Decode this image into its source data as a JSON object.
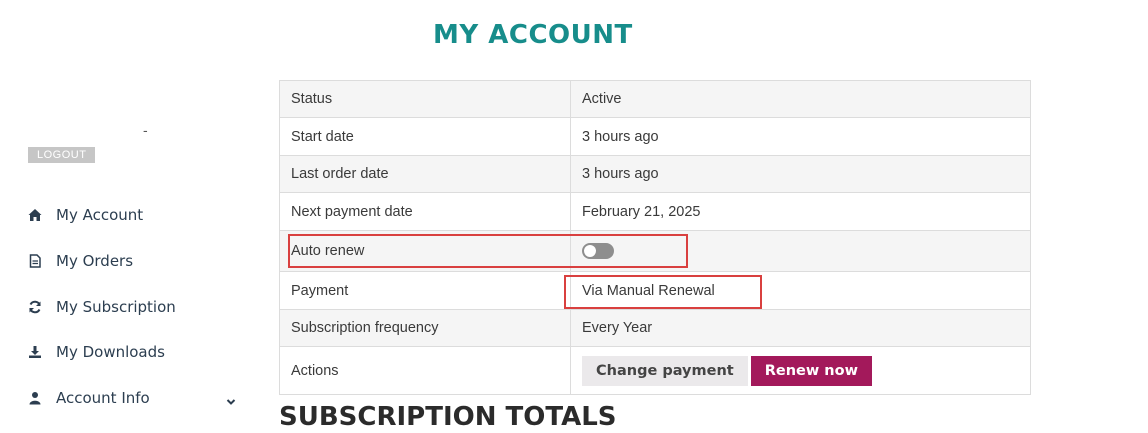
{
  "page": {
    "title": "MY ACCOUNT"
  },
  "sidebar": {
    "dash": "-",
    "logout_label": "LOGOUT",
    "items": [
      {
        "label": "My Account",
        "icon": "home-icon"
      },
      {
        "label": "My Orders",
        "icon": "document-icon"
      },
      {
        "label": "My Subscription",
        "icon": "refresh-icon"
      },
      {
        "label": "My Downloads",
        "icon": "download-icon"
      },
      {
        "label": "Account Info",
        "icon": "user-icon",
        "has_submenu": true
      }
    ]
  },
  "subscription": {
    "rows": {
      "status": {
        "label": "Status",
        "value": "Active"
      },
      "start_date": {
        "label": "Start date",
        "value": "3 hours ago"
      },
      "last_order_date": {
        "label": "Last order date",
        "value": "3 hours ago"
      },
      "next_payment_date": {
        "label": "Next payment date",
        "value": "February 21, 2025"
      },
      "auto_renew": {
        "label": "Auto renew",
        "enabled": false
      },
      "payment": {
        "label": "Payment",
        "value": "Via Manual Renewal"
      },
      "frequency": {
        "label": "Subscription frequency",
        "value": "Every Year"
      },
      "actions": {
        "label": "Actions",
        "change_payment_label": "Change payment",
        "renew_now_label": "Renew now"
      }
    }
  },
  "totals": {
    "title": "SUBSCRIPTION TOTALS"
  },
  "colors": {
    "accent_teal": "#178d8b",
    "renew_button": "#a3195b",
    "highlight": "#d9403f"
  }
}
